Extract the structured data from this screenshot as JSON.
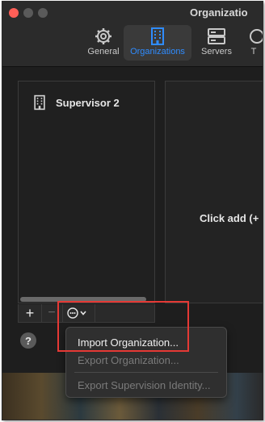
{
  "window": {
    "title": "Organizatio"
  },
  "toolbar": {
    "items": [
      {
        "label": "General",
        "icon": "gear-icon"
      },
      {
        "label": "Organizations",
        "icon": "building-icon",
        "selected": true
      },
      {
        "label": "Servers",
        "icon": "server-icon"
      },
      {
        "label": "T",
        "icon": "partial-icon"
      }
    ]
  },
  "organizations": {
    "list": [
      {
        "name": "Supervisor 2",
        "icon": "building-icon"
      }
    ],
    "add_label": "+",
    "remove_label": "−"
  },
  "detail": {
    "placeholder": "Click add (+"
  },
  "context_menu": {
    "items": [
      {
        "label": "Import Organization...",
        "enabled": true
      },
      {
        "label": "Export Organization...",
        "enabled": false
      },
      {
        "label": "Export Supervision Identity...",
        "enabled": false
      }
    ]
  },
  "help": {
    "label": "?"
  },
  "colors": {
    "accent": "#2f8cff",
    "highlight": "#e53935",
    "close": "#ff5f57"
  }
}
